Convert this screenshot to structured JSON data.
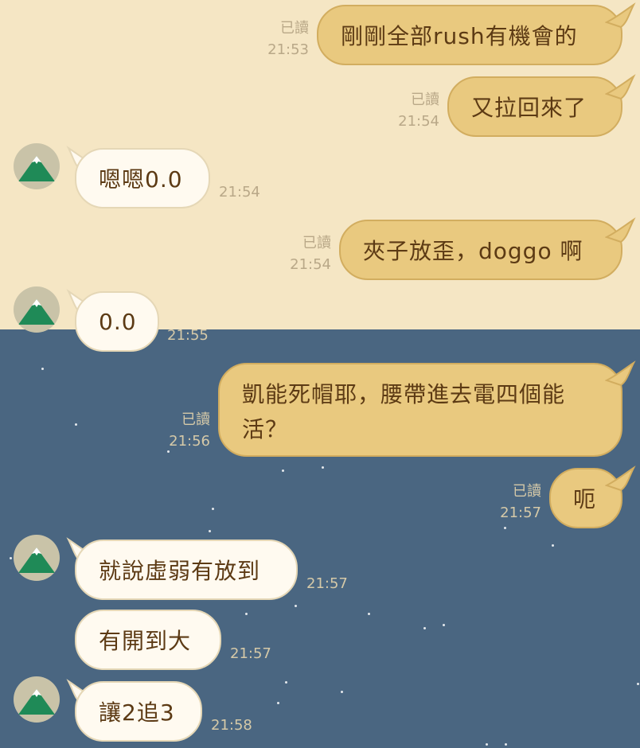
{
  "chat": {
    "read_label": "已讀",
    "messages": [
      {
        "side": "out",
        "text": "剛剛全部rush有機會的",
        "time": "21:53",
        "read": "已讀"
      },
      {
        "side": "out",
        "text": "又拉回來了",
        "time": "21:54",
        "read": "已讀"
      },
      {
        "side": "in",
        "text": "嗯嗯0.0",
        "time": "21:54"
      },
      {
        "side": "out",
        "text": "夾子放歪，doggo 啊",
        "time": "21:54",
        "read": "已讀"
      },
      {
        "side": "in",
        "text": "0.0",
        "time": "21:55"
      },
      {
        "side": "out",
        "text_line1": "凱能死帽耶，腰帶進去電四個能",
        "text_line2": "活？",
        "time": "21:56",
        "read": "已讀"
      },
      {
        "side": "out",
        "text": "呃",
        "time": "21:57",
        "read": "已讀"
      },
      {
        "side": "in",
        "text": "就說虛弱有放到",
        "time": "21:57"
      },
      {
        "side": "in",
        "text": "有開到大",
        "time": "21:57"
      },
      {
        "side": "in",
        "text": "讓2追3",
        "time": "21:58"
      }
    ]
  },
  "colors": {
    "background_top": "#f5e6c4",
    "background_bottom": "#4a6681",
    "outgoing_bubble": "#e9c97f",
    "incoming_bubble": "#fffaf0",
    "text": "#5c3a14"
  },
  "avatar": {
    "icon": "mountain-icon"
  }
}
